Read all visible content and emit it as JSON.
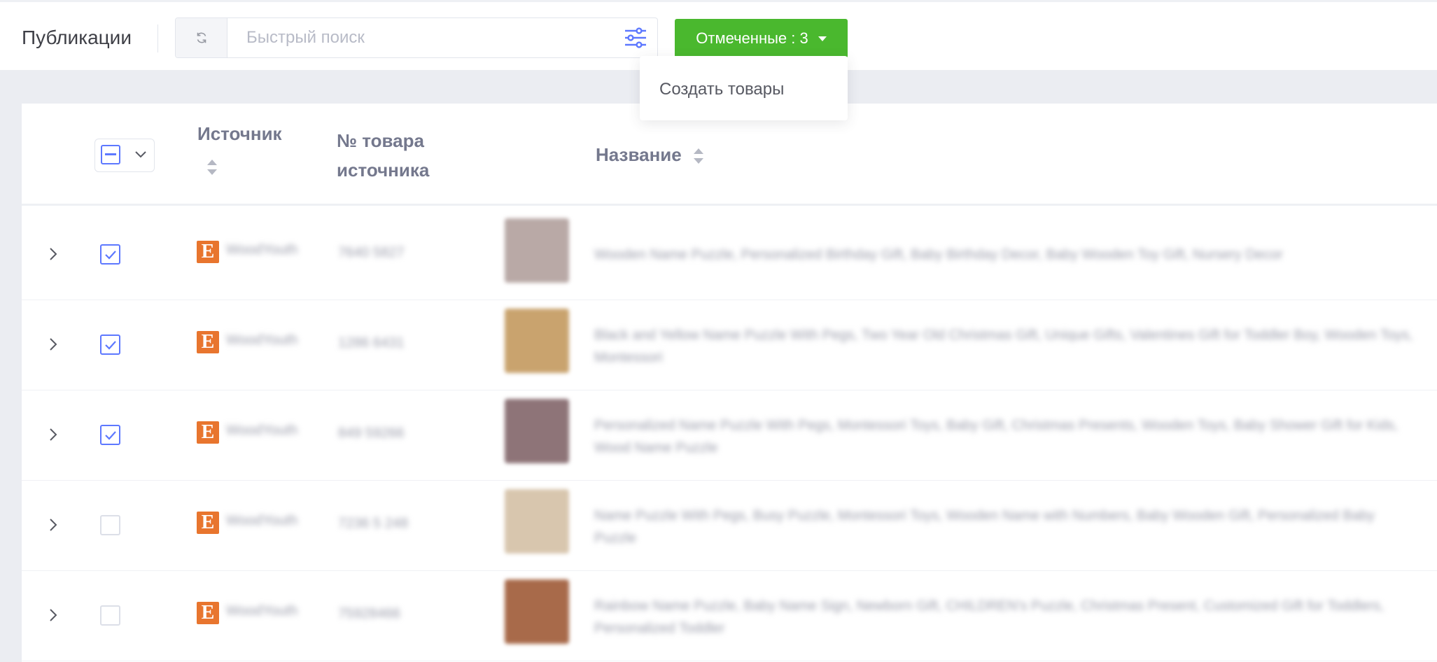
{
  "header": {
    "title": "Публикации",
    "search_placeholder": "Быстрый поиск",
    "marked_label": "Отмеченные : 3"
  },
  "dropdown": {
    "items": [
      {
        "label": "Создать товары"
      }
    ]
  },
  "table": {
    "columns": {
      "source": "Источник",
      "item_number": "№ товара источника",
      "name": "Название"
    },
    "rows": [
      {
        "checked": true,
        "shop": "WoodYouth",
        "item_no": "7640 5827",
        "title": "Wooden Name Puzzle, Personalized Birthday Gift, Baby Birthday Decor, Baby Wooden Toy Gift, Nursery Decor",
        "thumb_color": "#b9a9a6"
      },
      {
        "checked": true,
        "shop": "WoodYouth",
        "item_no": "1286 6431",
        "title": "Black and Yellow Name Puzzle With Pegs, Two Year Old Christmas Gift, Unique Gifts, Valentines Gift for Toddler Boy, Wooden Toys, Montessori",
        "thumb_color": "#c9a36e"
      },
      {
        "checked": true,
        "shop": "WoodYouth",
        "item_no": "849 59266",
        "title": "Personalized Name Puzzle With Pegs, Montessori Toys, Baby Gift, Christmas Presents, Wooden Toys, Baby Shower Gift for Kids, Wood Name Puzzle",
        "thumb_color": "#8e7478"
      },
      {
        "checked": false,
        "shop": "WoodYouth",
        "item_no": "7236 5 248",
        "title": "Name Puzzle With Pegs, Busy Puzzle, Montessori Toys, Wooden Name with Numbers, Baby Wooden Gift, Personalized Baby Puzzle",
        "thumb_color": "#d8c6ae"
      },
      {
        "checked": false,
        "shop": "WoodYouth",
        "item_no": "75928466",
        "title": "Rainbow Name Puzzle, Baby Name Sign, Newborn Gift, CHILDREN's Puzzle, Christmas Present, Customized Gift for Toddlers, Personalized Toddler",
        "thumb_color": "#a86a4a"
      }
    ]
  }
}
